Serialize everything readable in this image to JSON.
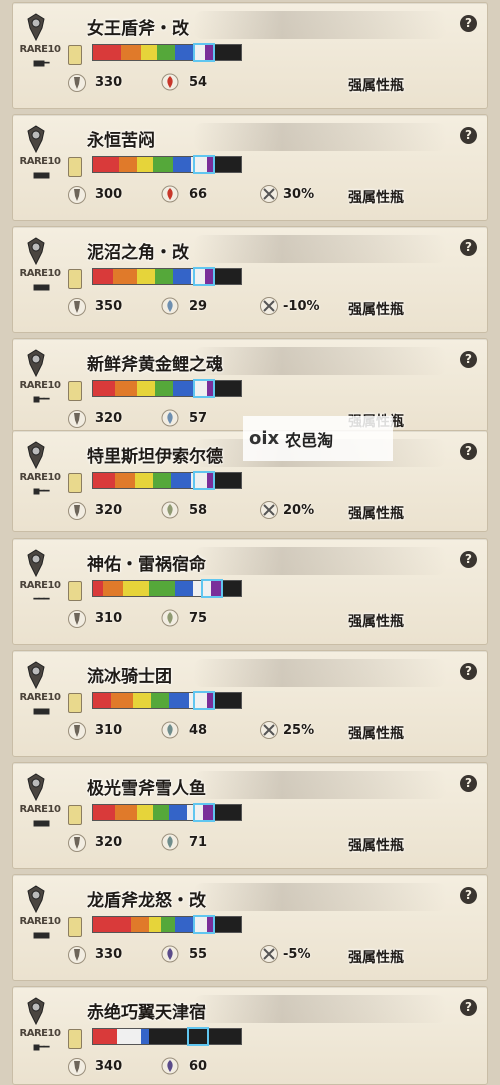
{
  "weapons": [
    {
      "name": "女王盾斧・改",
      "rare": "RARE10",
      "slots": "■■━",
      "attack": "330",
      "element": "54",
      "affinity": "",
      "phial": "强属性瓶",
      "element_type": "fire",
      "colors": [
        "#d93a3a",
        "#e07a2a",
        "#e6d43a",
        "#55a83a",
        "#3464c8",
        "#f0f0f0",
        "#7a2f9a"
      ],
      "widths": [
        28,
        20,
        16,
        18,
        18,
        12,
        10
      ]
    },
    {
      "name": "永恒苦闷",
      "rare": "RARE10",
      "slots": "■■■",
      "attack": "300",
      "element": "66",
      "affinity": "30%",
      "phial": "强属性瓶",
      "element_type": "fire",
      "colors": [
        "#d93a3a",
        "#e07a2a",
        "#e6d43a",
        "#55a83a",
        "#3464c8",
        "#f0f0f0",
        "#7a2f9a"
      ],
      "widths": [
        26,
        18,
        16,
        20,
        18,
        16,
        8
      ]
    },
    {
      "name": "泥沼之角・改",
      "rare": "RARE10",
      "slots": "■■■",
      "attack": "350",
      "element": "29",
      "affinity": "-10%",
      "phial": "强属性瓶",
      "element_type": "water",
      "colors": [
        "#d93a3a",
        "#e07a2a",
        "#e6d43a",
        "#55a83a",
        "#3464c8",
        "#f0f0f0",
        "#7a2f9a"
      ],
      "widths": [
        20,
        24,
        18,
        18,
        18,
        14,
        10
      ]
    },
    {
      "name": "新鲜斧黄金鲤之魂",
      "rare": "RARE10",
      "slots": "■━━",
      "attack": "320",
      "element": "57",
      "affinity": "",
      "phial": "强属性瓶",
      "element_type": "water",
      "colors": [
        "#d93a3a",
        "#e07a2a",
        "#e6d43a",
        "#55a83a",
        "#3464c8",
        "#f0f0f0",
        "#7a2f9a"
      ],
      "widths": [
        22,
        22,
        18,
        18,
        20,
        14,
        8
      ]
    },
    {
      "name": "特里斯坦伊索尔德",
      "rare": "RARE10",
      "slots": "■━━",
      "attack": "320",
      "element": "58",
      "affinity": "20%",
      "phial": "强属性瓶",
      "element_type": "thunder",
      "colors": [
        "#d93a3a",
        "#e07a2a",
        "#e6d43a",
        "#55a83a",
        "#3464c8",
        "#f0f0f0",
        "#7a2f9a"
      ],
      "widths": [
        22,
        20,
        18,
        18,
        20,
        16,
        8
      ]
    },
    {
      "name": "神佑・雷祸宿命",
      "rare": "RARE10",
      "slots": "━━━",
      "attack": "310",
      "element": "75",
      "affinity": "",
      "phial": "强属性瓶",
      "element_type": "thunder",
      "colors": [
        "#d93a3a",
        "#e07a2a",
        "#e6d43a",
        "#55a83a",
        "#3464c8",
        "#f0f0f0",
        "#7a2f9a"
      ],
      "widths": [
        10,
        20,
        26,
        26,
        18,
        18,
        12
      ]
    },
    {
      "name": "流冰骑士团",
      "rare": "RARE10",
      "slots": "■■■",
      "attack": "310",
      "element": "48",
      "affinity": "25%",
      "phial": "强属性瓶",
      "element_type": "ice",
      "colors": [
        "#d93a3a",
        "#e07a2a",
        "#e6d43a",
        "#55a83a",
        "#3464c8",
        "#f0f0f0",
        "#7a2f9a"
      ],
      "widths": [
        18,
        22,
        18,
        18,
        20,
        18,
        8
      ]
    },
    {
      "name": "极光雪斧雪人鱼",
      "rare": "RARE10",
      "slots": "■■■",
      "attack": "320",
      "element": "71",
      "affinity": "",
      "phial": "强属性瓶",
      "element_type": "ice",
      "colors": [
        "#d93a3a",
        "#e07a2a",
        "#e6d43a",
        "#55a83a",
        "#3464c8",
        "#f0f0f0",
        "#7a2f9a"
      ],
      "widths": [
        22,
        22,
        16,
        16,
        18,
        16,
        12
      ]
    },
    {
      "name": "龙盾斧龙怒・改",
      "rare": "RARE10",
      "slots": "■■■",
      "attack": "330",
      "element": "55",
      "affinity": "-5%",
      "phial": "强属性瓶",
      "element_type": "dragon",
      "colors": [
        "#d93a3a",
        "#e07a2a",
        "#e6d43a",
        "#55a83a",
        "#3464c8",
        "#f0f0f0",
        "#7a2f9a"
      ],
      "widths": [
        38,
        18,
        12,
        14,
        18,
        14,
        8
      ]
    },
    {
      "name": "赤绝巧翼天津宿",
      "rare": "RARE10",
      "slots": "■━━",
      "attack": "340",
      "element": "60",
      "affinity": "",
      "phial": "",
      "element_type": "dragon",
      "colors": [
        "#d93a3a",
        "#e07a2a",
        "#f0f0f0",
        "#3464c8",
        "#1f1f1f",
        "#1f1f1f",
        "#1f1f1f"
      ],
      "widths": [
        24,
        0,
        24,
        8,
        20,
        20,
        20
      ]
    }
  ],
  "watermark": {
    "logo": "oix",
    "text": "农邑淘"
  },
  "help_label": "?"
}
